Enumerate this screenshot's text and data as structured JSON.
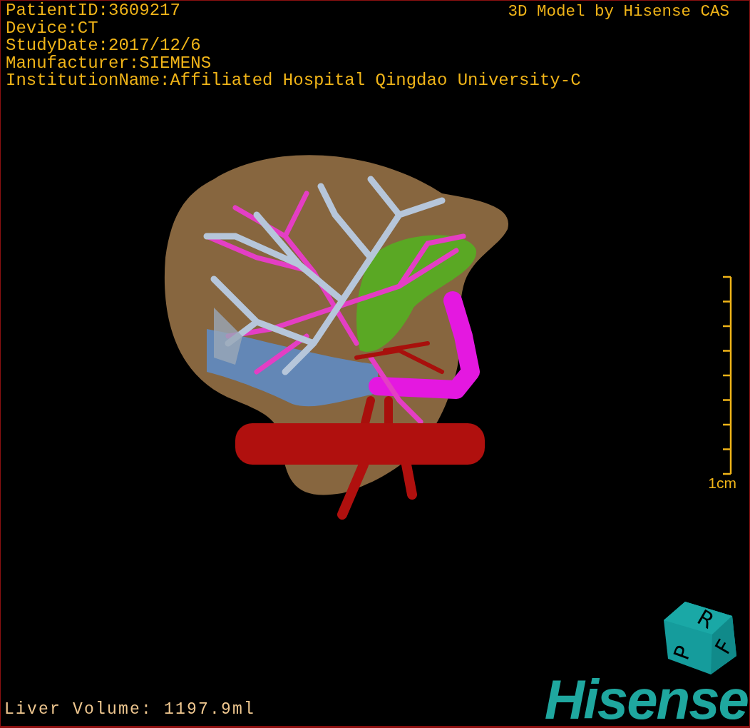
{
  "patient_info": [
    "PatientID:3609217",
    "Device:CT",
    "StudyDate:2017/12/6",
    "Manufacturer:SIEMENS",
    "InstitutionName:Affiliated Hospital Qingdao University-C"
  ],
  "model_credit": "3D Model by Hisense CAS",
  "scale_bar": {
    "label": "1cm"
  },
  "orientation_cube": {
    "faces": [
      "P",
      "R",
      "F"
    ]
  },
  "liver_volume": "Liver Volume: 1197.9ml",
  "logo": "Hisense"
}
